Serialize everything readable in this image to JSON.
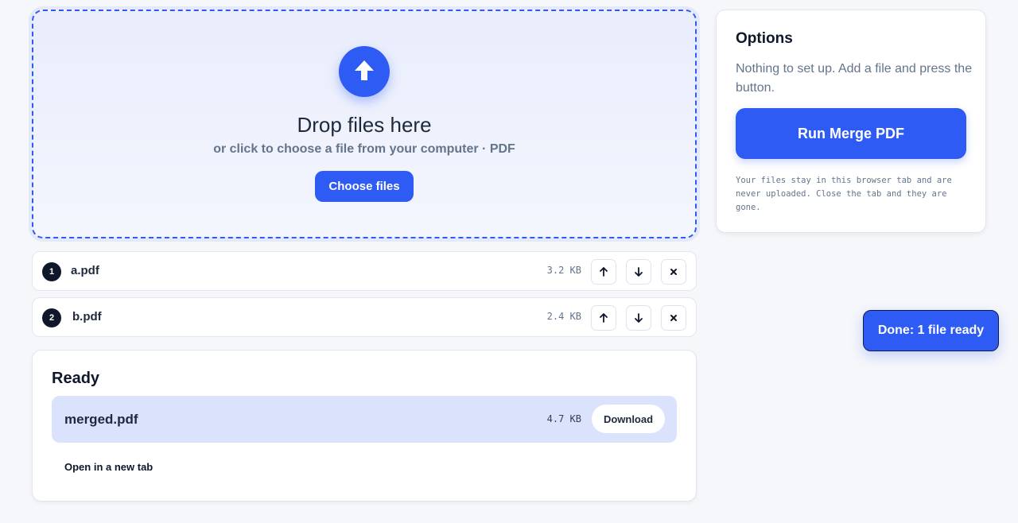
{
  "dropzone": {
    "title": "Drop files here",
    "subtitle": "or click to choose a file from your computer · PDF",
    "choose_label": "Choose files",
    "icon": "upload-arrow-icon"
  },
  "files": [
    {
      "index": "1",
      "name": "a.pdf",
      "size": "3.2 KB"
    },
    {
      "index": "2",
      "name": "b.pdf",
      "size": "2.4 KB"
    }
  ],
  "result": {
    "title": "Ready",
    "file_name": "merged.pdf",
    "file_size": "4.7 KB",
    "download_label": "Download",
    "open_link": "Open in a new tab"
  },
  "options": {
    "title": "Options",
    "description": "Nothing to set up. Add a file and press the button.",
    "run_label": "Run Merge PDF",
    "privacy_note": "Your files stay in this browser tab and are never uploaded. Close the tab and they are gone."
  },
  "toast": {
    "text": "Done: 1 file ready"
  },
  "colors": {
    "accent": "#2f5bf5",
    "background": "#f6f7fb",
    "result_bg": "#dbe3fc"
  }
}
